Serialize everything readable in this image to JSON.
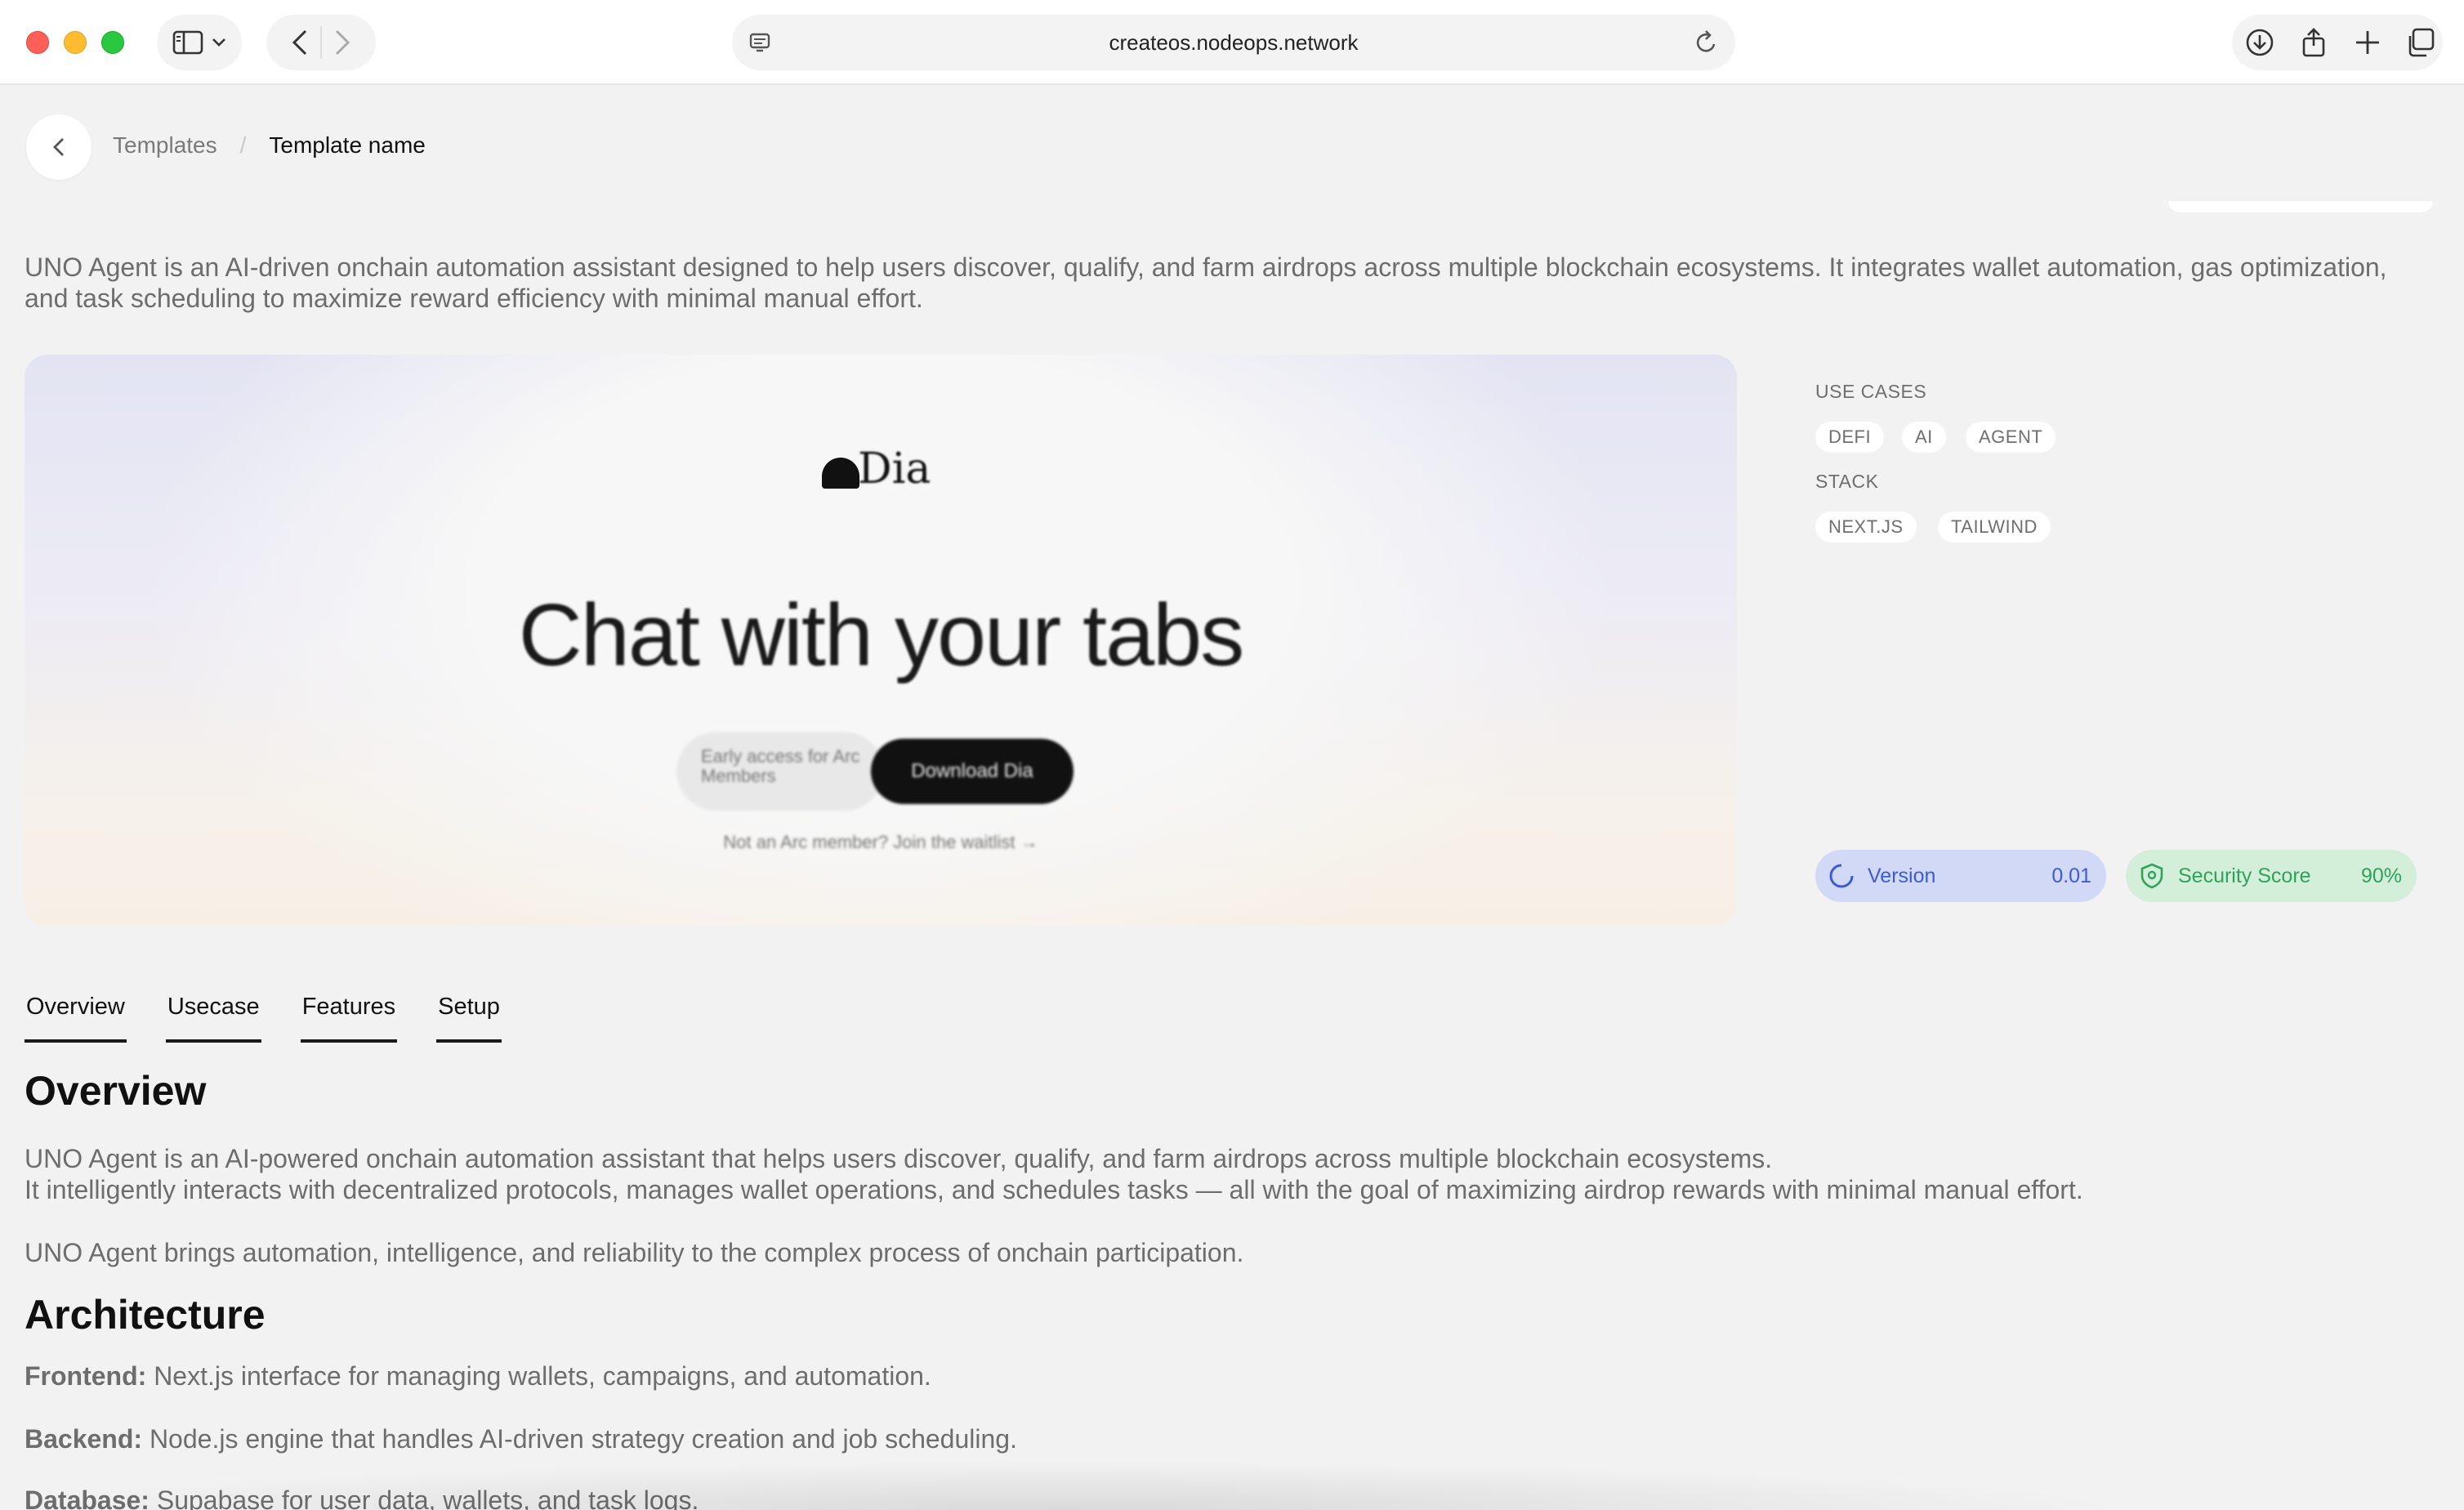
{
  "browser": {
    "url": "createos.nodeops.network"
  },
  "breadcrumb": {
    "parent": "Templates",
    "separator": "/",
    "current": "Template name"
  },
  "template": {
    "description": "UNO Agent is an AI-driven onchain automation assistant designed to help users discover, qualify, and farm airdrops across multiple blockchain ecosystems. It integrates wallet automation, gas optimization, and task scheduling to maximize reward efficiency with minimal manual effort."
  },
  "preview": {
    "logo_text": "Dia",
    "hero": "Chat with your tabs",
    "secondary_cta": "Early access for Arc Members",
    "primary_cta": "Download Dia",
    "waitlist_text": "Not an Arc member? Join the waitlist →"
  },
  "sidebar": {
    "use_cases_label": "USE CASES",
    "use_cases": [
      "DEFI",
      "AI",
      "AGENT"
    ],
    "stack_label": "STACK",
    "stack": [
      "NEXT.JS",
      "TAILWIND"
    ],
    "version": {
      "label": "Version",
      "value": "0.01"
    },
    "security": {
      "label": "Security Score",
      "value": "90%"
    }
  },
  "tabs": [
    "Overview",
    "Usecase",
    "Features",
    "Setup"
  ],
  "overview": {
    "heading": "Overview",
    "p1_line1": "UNO Agent is an AI-powered onchain automation assistant that helps users discover, qualify, and farm airdrops across multiple blockchain ecosystems.",
    "p1_line2": "It intelligently interacts with decentralized protocols, manages wallet operations, and schedules tasks — all with the goal of maximizing airdrop rewards with minimal manual effort.",
    "p2": "UNO Agent brings automation, intelligence, and reliability to the complex process of onchain participation."
  },
  "architecture": {
    "heading": "Architecture",
    "items": [
      {
        "label": "Frontend:",
        "text": " Next.js interface for managing wallets, campaigns, and automation."
      },
      {
        "label": "Backend:",
        "text": " Node.js engine that handles AI-driven strategy creation and job scheduling."
      },
      {
        "label": "Database:",
        "text": " Supabase for user data, wallets, and task logs."
      }
    ]
  },
  "colors": {
    "version_bg": "#d1d9f7",
    "version_fg": "#3d5bd9",
    "security_bg": "#d3efda",
    "security_fg": "#2fa35a"
  }
}
